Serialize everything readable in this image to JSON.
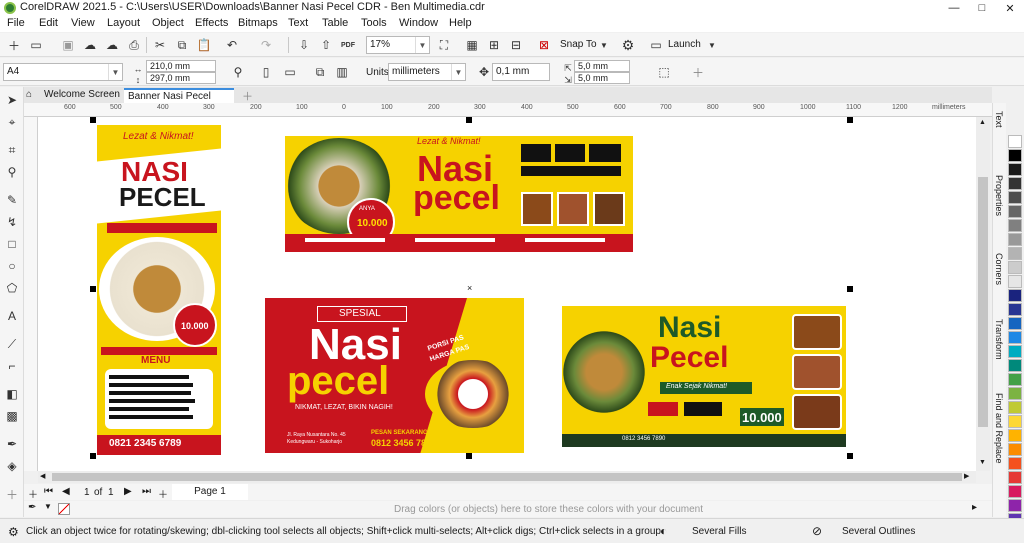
{
  "window": {
    "title": "CorelDRAW 2021.5 - C:\\Users\\USER\\Downloads\\Banner Nasi Pecel CDR - Ben Multimedia.cdr",
    "minimize": "—",
    "maximize": "□",
    "close": "✕"
  },
  "menu": [
    "File",
    "Edit",
    "View",
    "Layout",
    "Object",
    "Effects",
    "Bitmaps",
    "Text",
    "Table",
    "Tools",
    "Window",
    "Help"
  ],
  "std_toolbar": {
    "zoom": "17%",
    "snap_to": "Snap To",
    "launch": "Launch",
    "pdf": "PDF"
  },
  "property_bar": {
    "page_size": "A4",
    "width": "210,0 mm",
    "height": "297,0 mm",
    "units_label": "Units:",
    "units": "millimeters",
    "nudge": "0,1 mm",
    "dup_x": "5,0 mm",
    "dup_y": "5,0 mm"
  },
  "doc_tabs": {
    "welcome": "Welcome Screen",
    "active": "Banner Nasi Pecel CD..."
  },
  "ruler": {
    "units": "millimeters",
    "ticks": [
      "600",
      "500",
      "400",
      "300",
      "200",
      "100",
      "0",
      "100",
      "200",
      "300",
      "400",
      "500",
      "600",
      "700",
      "800",
      "900",
      "1000",
      "1100",
      "1200"
    ]
  },
  "artwork": {
    "b1": {
      "tagline": "Lezat & Nikmat!",
      "line1": "NASI",
      "line2": "PECEL",
      "menu": "MENU",
      "price": "10.000",
      "phone": "0821 2345 6789"
    },
    "b2": {
      "tagline": "Lezat & Nikmat!",
      "line1": "Nasi",
      "line2": "pecel",
      "price_tag": "ANYA",
      "price": "10.000"
    },
    "b3": {
      "special": "SPESIAL",
      "line1": "Nasi",
      "line2": "pecel",
      "badge1": "PORSI PAS",
      "badge2": "HARGA PAS",
      "slogan": "NIKMAT, LEZAT, BIKIN NAGIH!",
      "address1": "Jl. Raya Nusantara No. 45",
      "address2": "Kedungwaru - Sukoharjo",
      "order_label": "PESAN SEKARANG!",
      "order_phone": "0812 3456 7890"
    },
    "b4": {
      "line1": "Nasi",
      "line2": "Pecel",
      "tagline": "Enak Sejak Nikmat!",
      "price": "10.000",
      "phone": "0812 3456 7890"
    }
  },
  "docker_tabs": [
    "Text",
    "Properties",
    "Corners",
    "Transform",
    "Find and Replace"
  ],
  "palette": [
    "#ffffff",
    "#000000",
    "#1a1a1a",
    "#333333",
    "#4d4d4d",
    "#666666",
    "#808080",
    "#999999",
    "#b3b3b3",
    "#cccccc",
    "#e6e6e6",
    "#1a237e",
    "#283593",
    "#1565c0",
    "#1e88e5",
    "#00acc1",
    "#00897b",
    "#43a047",
    "#7cb342",
    "#c0ca33",
    "#fdd835",
    "#ffb300",
    "#fb8c00",
    "#f4511e",
    "#e53935",
    "#d81b60",
    "#8e24aa",
    "#5e35b1"
  ],
  "page_nav": {
    "current": "1",
    "of": "of",
    "total": "1",
    "page_tab": "Page 1"
  },
  "colorbar": {
    "hint": "Drag colors (or objects) here to store these colors with your document"
  },
  "status": {
    "hint": "Click an object twice for rotating/skewing; dbl-clicking tool selects all objects; Shift+click multi-selects; Alt+click digs; Ctrl+click selects in a group",
    "fills": "Several Fills",
    "outlines": "Several Outlines"
  }
}
